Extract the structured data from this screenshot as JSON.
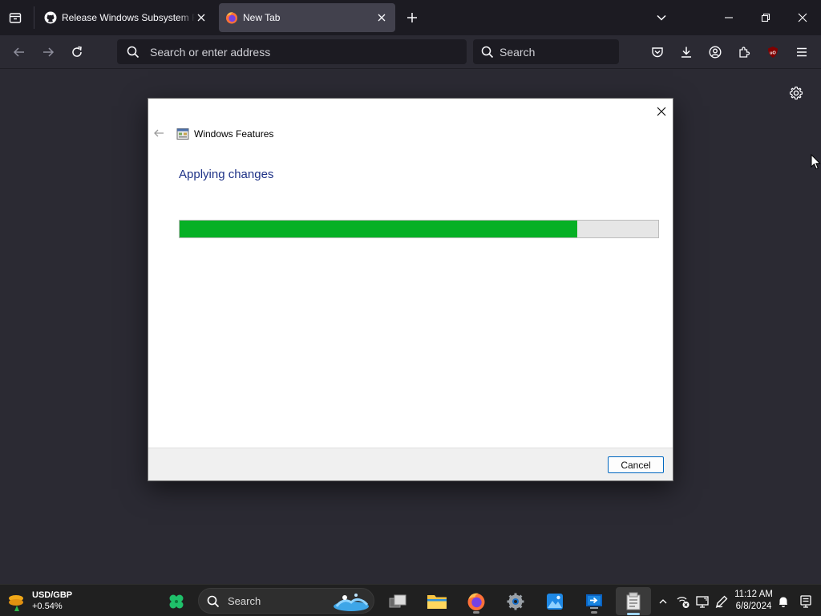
{
  "browser": {
    "tabs": [
      {
        "title": "Release Windows Subsystem Fo",
        "active": false
      },
      {
        "title": "New Tab",
        "active": true
      }
    ],
    "address_placeholder": "Search or enter address",
    "search_placeholder": "Search"
  },
  "dialog": {
    "title": "Windows Features",
    "heading": "Applying changes",
    "progress_fraction": 0.83,
    "cancel_label": "Cancel"
  },
  "taskbar": {
    "widget": {
      "pair": "USD/GBP",
      "change": "+0.54%"
    },
    "search_label": "Search",
    "clock": {
      "time": "11:12 AM",
      "date": "6/8/2024"
    }
  },
  "colors": {
    "progress_fill": "#06b025",
    "progress_track": "#e6e6e6",
    "heading": "#1e3287"
  }
}
